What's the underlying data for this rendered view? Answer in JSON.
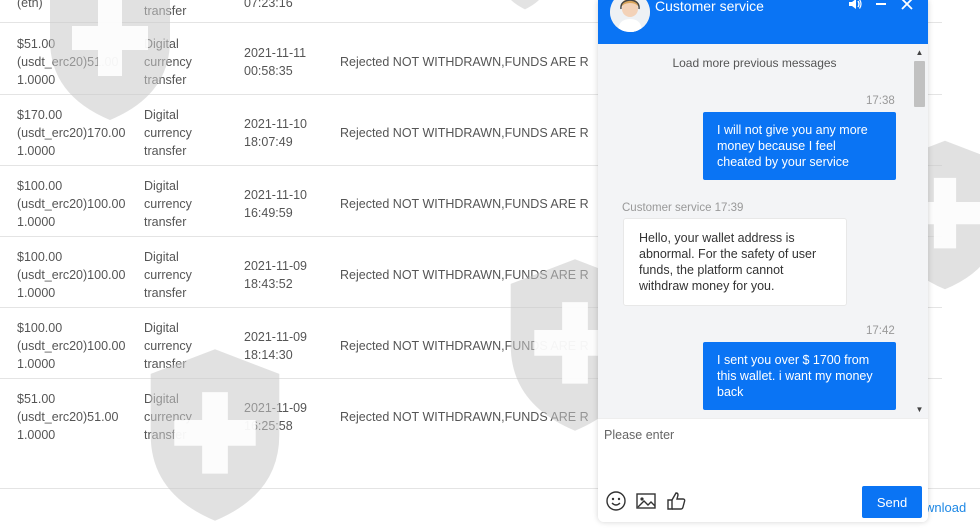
{
  "table": {
    "partial_row": {
      "amount": "(eth)",
      "method": "transfer",
      "time": "07:23:16"
    },
    "rows": [
      {
        "amount": "$51.00\n(usdt_erc20)51.00\n1.0000",
        "method": "Digital\ncurrency\ntransfer",
        "time": "2021-11-11\n00:58:35",
        "status": "Rejected NOT WITHDRAWN,FUNDS ARE R"
      },
      {
        "amount": "$170.00\n(usdt_erc20)170.00\n1.0000",
        "method": "Digital\ncurrency\ntransfer",
        "time": "2021-11-10\n18:07:49",
        "status": "Rejected NOT WITHDRAWN,FUNDS ARE R"
      },
      {
        "amount": "$100.00\n(usdt_erc20)100.00\n1.0000",
        "method": "Digital\ncurrency\ntransfer",
        "time": "2021-11-10\n16:49:59",
        "status": "Rejected NOT WITHDRAWN,FUNDS ARE R"
      },
      {
        "amount": "$100.00\n(usdt_erc20)100.00\n1.0000",
        "method": "Digital\ncurrency\ntransfer",
        "time": "2021-11-09\n18:43:52",
        "status": "Rejected NOT WITHDRAWN,FUNDS ARE R"
      },
      {
        "amount": "$100.00\n(usdt_erc20)100.00\n1.0000",
        "method": "Digital\ncurrency\ntransfer",
        "time": "2021-11-09\n18:14:30",
        "status": "Rejected NOT WITHDRAWN,FUNDS ARE R"
      },
      {
        "amount": "$51.00\n(usdt_erc20)51.00\n1.0000",
        "method": "Digital\ncurrency\ntransfer",
        "time": "2021-11-09\n16:25:58",
        "status": "Rejected NOT WITHDRAWN,FUNDS ARE R"
      }
    ],
    "download_label": "wnload"
  },
  "chat": {
    "title": "Customer service",
    "header_icons": [
      "speaker-icon",
      "minimize-icon",
      "close-icon"
    ],
    "load_more": "Load more previous messages",
    "messages": [
      {
        "direction": "out",
        "timestamp": "17:38",
        "text": "I will not give you any more money because I feel cheated by your service"
      },
      {
        "direction": "in",
        "sender_time": "Customer service 17:39",
        "text": "Hello, your wallet address is abnormal. For the safety of user funds, the platform cannot withdraw money for you."
      },
      {
        "direction": "out",
        "timestamp": "17:42",
        "text": "I sent you over $ 1700 from this wallet. i want my money back"
      }
    ],
    "input_placeholder": "Please enter",
    "input_value": "",
    "toolbar_icons": [
      "emoji-icon",
      "image-icon",
      "thumbs-up-icon"
    ],
    "send_label": "Send",
    "accent_color": "#0a74f4"
  }
}
